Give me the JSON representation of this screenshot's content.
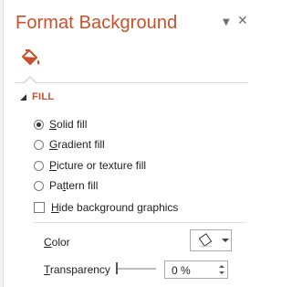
{
  "pane": {
    "title": "Format Background",
    "title_color": "#c8502a",
    "pin_icon": "chevron-down-icon",
    "close_icon": "close-icon",
    "active_tab_icon": "fill-bucket-icon"
  },
  "fill_section": {
    "label": "FILL",
    "expanded": true,
    "options": [
      {
        "access_key": "S",
        "rest": "olid fill",
        "checked": true
      },
      {
        "access_key": "G",
        "rest": "radient fill",
        "checked": false
      },
      {
        "access_key": "P",
        "rest": "icture or texture fill",
        "checked": false
      },
      {
        "prefix": "Pa",
        "access_key": "t",
        "rest": "tern fill",
        "checked": false
      }
    ],
    "hide_graphics": {
      "access_key": "H",
      "rest": "ide background graphics",
      "checked": false
    },
    "color": {
      "access_key": "C",
      "rest": "olor",
      "icon": "paint-bucket-icon"
    },
    "transparency": {
      "access_key": "T",
      "rest": "ransparency",
      "value": "0 %",
      "level": 0
    }
  }
}
